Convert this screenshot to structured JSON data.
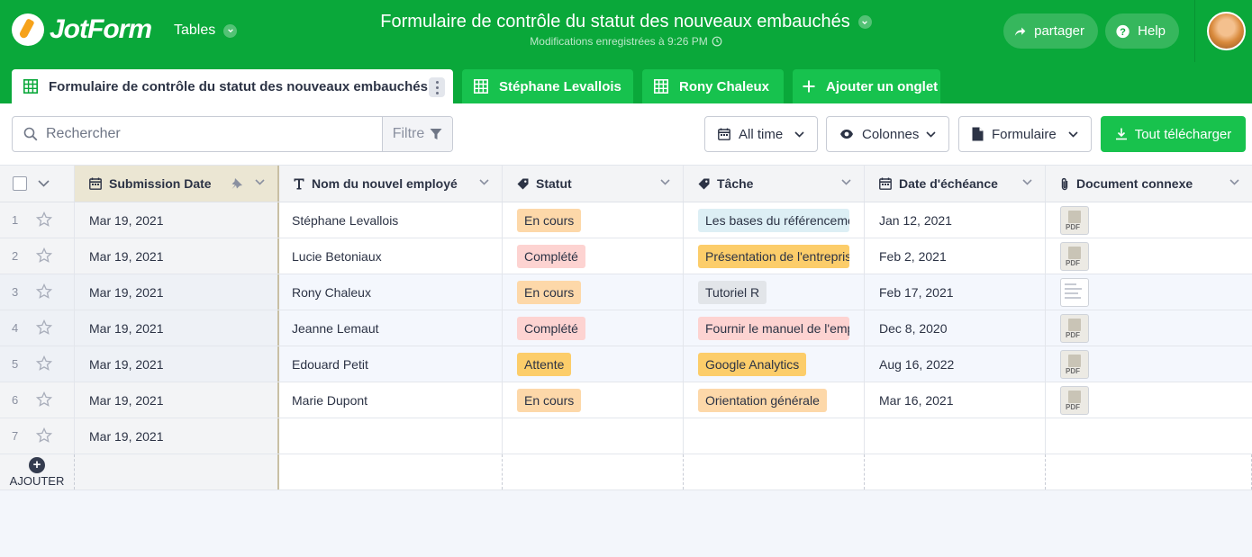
{
  "app": {
    "logo_text": "JotForm",
    "tables_label": "Tables",
    "title": "Formulaire de contrôle du statut des nouveaux embauchés",
    "saved_status": "Modifications enregistrées à 9:26 PM",
    "share_label": "partager",
    "help_label": "Help",
    "accent_color": "#0aa83a"
  },
  "tabs": [
    {
      "label": "Formulaire de contrôle du statut des nouveaux embauchés",
      "active": true
    },
    {
      "label": "Stéphane Levallois",
      "active": false
    },
    {
      "label": "Rony Chaleux",
      "active": false
    }
  ],
  "add_tab_label": "Ajouter un onglet",
  "toolbar": {
    "search_placeholder": "Rechercher",
    "filter_label": "Filtre",
    "time_label": "All time",
    "columns_label": "Colonnes",
    "form_label": "Formulaire",
    "download_label": "Tout télécharger"
  },
  "columns": [
    {
      "label": "Submission Date",
      "icon": "calendar-icon"
    },
    {
      "label": "Nom du nouvel employé",
      "icon": "text-icon"
    },
    {
      "label": "Statut",
      "icon": "tag-icon"
    },
    {
      "label": "Tâche",
      "icon": "tag-icon"
    },
    {
      "label": "Date d'échéance",
      "icon": "calendar-icon"
    },
    {
      "label": "Document connexe",
      "icon": "paperclip-icon"
    }
  ],
  "rows": [
    {
      "num": "1",
      "date": "Mar 19, 2021",
      "name": "Stéphane Levallois",
      "status": "En cours",
      "task": "Les bases du référencement",
      "due": "Jan 12, 2021",
      "doc": "PDF"
    },
    {
      "num": "2",
      "date": "Mar 19, 2021",
      "name": "Lucie Betoniaux",
      "status": "Complété",
      "task": "Présentation de l'entreprise",
      "due": "Feb 2, 2021",
      "doc": "PDF"
    },
    {
      "num": "3",
      "date": "Mar 19, 2021",
      "name": "Rony Chaleux",
      "status": "En cours",
      "task": "Tutoriel R",
      "due": "Feb 17, 2021",
      "doc": "document"
    },
    {
      "num": "4",
      "date": "Mar 19, 2021",
      "name": "Jeanne Lemaut",
      "status": "Complété",
      "task": "Fournir le manuel de l'employé",
      "due": "Dec 8, 2020",
      "doc": "PDF"
    },
    {
      "num": "5",
      "date": "Mar 19, 2021",
      "name": "Edouard Petit",
      "status": "Attente",
      "task": "Google Analytics",
      "due": "Aug 16, 2022",
      "doc": "PDF"
    },
    {
      "num": "6",
      "date": "Mar 19, 2021",
      "name": "Marie Dupont",
      "status": "En cours",
      "task": "Orientation générale",
      "due": "Mar 16, 2021",
      "doc": "PDF"
    },
    {
      "num": "7",
      "date": "Mar 19, 2021",
      "name": "",
      "status": "",
      "task": "",
      "due": "",
      "doc": ""
    }
  ],
  "tag_colors": {
    "En cours": "#fdd8a9",
    "Complété": "#fdd3d1",
    "Attente": "#fccd6a",
    "Les bases du référencement": "#ddeff5",
    "Présentation de l'entreprise": "#fccd6a",
    "Tutoriel R": "#e2e5e9",
    "Fournir le manuel de l'employé": "#fdd3d1",
    "Google Analytics": "#fccd6a",
    "Orientation générale": "#fdd8a9"
  },
  "add_row_label": "AJOUTER"
}
